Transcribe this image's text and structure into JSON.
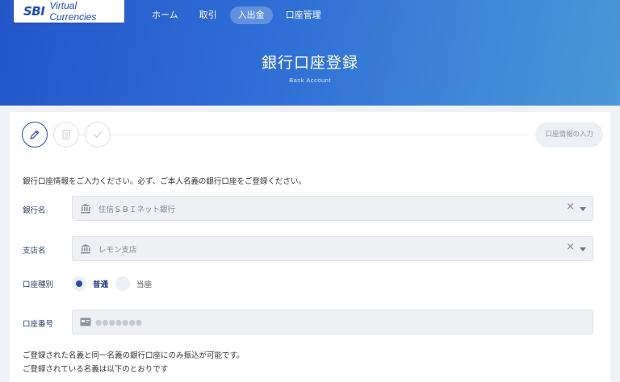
{
  "header": {
    "logo_mark": "SBI",
    "logo_text": "Virtual Currencies",
    "nav": [
      {
        "label": "ホーム",
        "active": false
      },
      {
        "label": "取引",
        "active": false
      },
      {
        "label": "入出金",
        "active": true
      },
      {
        "label": "口座管理",
        "active": false
      }
    ],
    "title": "銀行口座登録",
    "subtitle": "Bank Account"
  },
  "steps": {
    "badge": "口座情報の入力",
    "icons": [
      "pencil-icon",
      "document-icon",
      "check-icon"
    ]
  },
  "form": {
    "instruction": "銀行口座情報をご入力ください。必ず、ご本人名義の銀行口座をご登録ください。",
    "bank": {
      "label": "銀行名",
      "value": "住信ＳＢＩネット銀行",
      "clear": "×"
    },
    "branch": {
      "label": "支店名",
      "value": "レモン支店",
      "clear": "×"
    },
    "account_type": {
      "label": "口座種別",
      "options": [
        {
          "label": "普通",
          "checked": true
        },
        {
          "label": "当座",
          "checked": false
        }
      ]
    },
    "account_number": {
      "label": "口座番号",
      "value": "",
      "placeholder": "●●●●●●●"
    }
  },
  "notes": {
    "line1": "ご登録された名義と同一名義の銀行口座にのみ振込が可能です。",
    "line2": "ご登録されている名義は以下のとおりです"
  },
  "colors": {
    "primary": "#2a4aa8",
    "header_start": "#2456c9",
    "header_end": "#4a98d6"
  }
}
